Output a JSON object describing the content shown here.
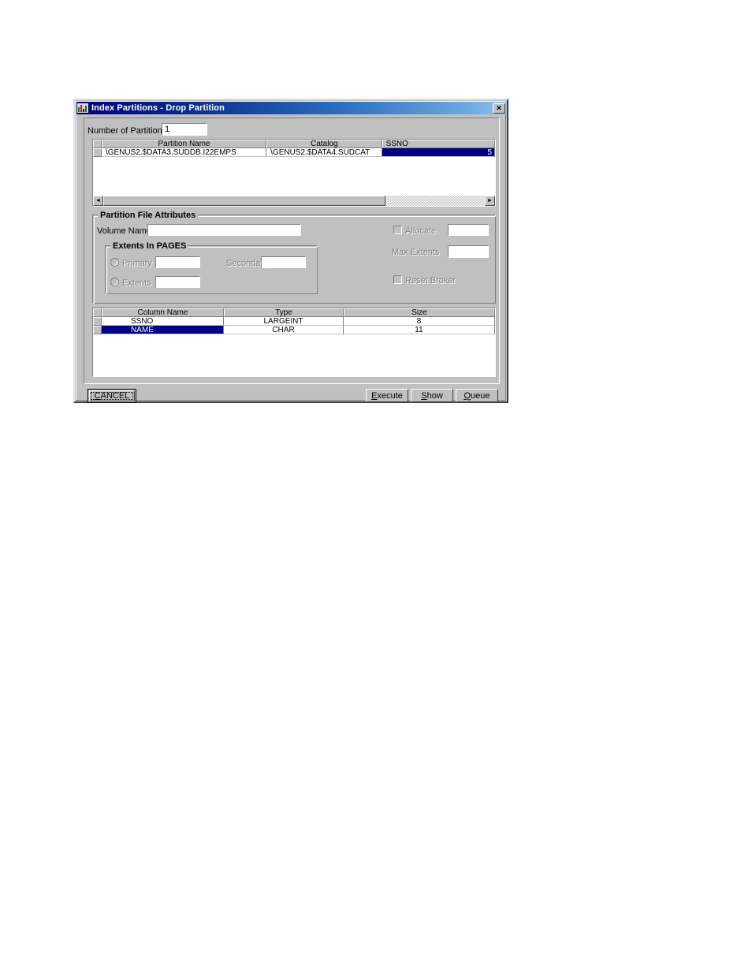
{
  "window": {
    "title": "Index Partitions - Drop Partition",
    "icon": "app-chart-icon",
    "close_label": "✕",
    "titlebar_color": "#000080",
    "face_color": "#c0c0c0",
    "selection_color": "#000080"
  },
  "form": {
    "number_of_partitions_label": "Number of Partitions",
    "number_of_partitions_value": "1"
  },
  "partitions_grid": {
    "columns": [
      "Partition Name",
      "Catalog",
      "SSNO"
    ],
    "rows": [
      {
        "partition_name": "\\GENUS2.$DATA3.SUDDB.I22EMPS",
        "catalog": "\\GENUS2.$DATA4.SUDCAT",
        "ssno": "5",
        "ssno_selected": true
      }
    ],
    "hscroll": {
      "left_arrow": "◄",
      "right_arrow": "►"
    }
  },
  "attributes": {
    "group_title": "Partition File Attributes",
    "volume_name_label": "Volume Name",
    "volume_name_value": "",
    "extents_group_title": "Extents In PAGES",
    "primary_label": "Primary",
    "primary_value": "",
    "primary_selected": false,
    "secondary_label": "Secondary",
    "secondary_value": "",
    "extents_label": "Extents",
    "extents_value": "",
    "extents_selected": false,
    "allocate_label": "Allocate",
    "allocate_checked": false,
    "allocate_value": "",
    "max_extents_label": "Max Extents",
    "max_extents_value": "",
    "reset_broker_label": "Reset Broker",
    "reset_broker_checked": false
  },
  "columns_grid": {
    "columns": [
      "Column Name",
      "Type",
      "Size"
    ],
    "rows": [
      {
        "name": "SSNO",
        "type": "LARGEINT",
        "size": "8",
        "selected": false
      },
      {
        "name": "NAME",
        "type": "CHAR",
        "size": "11",
        "selected": true
      }
    ]
  },
  "buttons": {
    "cancel": "CANCEL",
    "cancel_accesskey": "C",
    "execute": "Execute",
    "execute_accesskey": "E",
    "show": "Show",
    "show_accesskey": "S",
    "queue": "Queue",
    "queue_accesskey": "Q"
  }
}
